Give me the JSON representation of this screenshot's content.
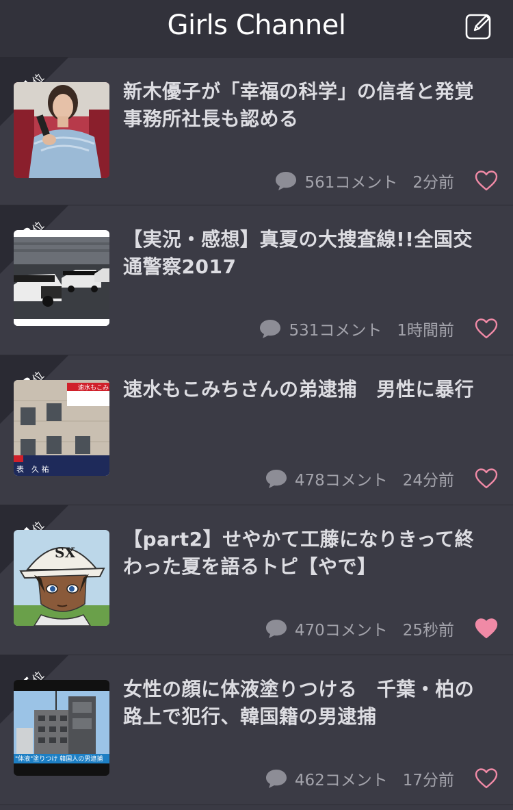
{
  "header": {
    "title": "Girls Channel",
    "compose_icon": "compose-icon"
  },
  "colors": {
    "background": "#3a3a44",
    "header": "#32323b",
    "heart": "#f08aa6",
    "text": "#dddde2",
    "meta": "#a3a3ab"
  },
  "unit": "位",
  "items": [
    {
      "rank": "11",
      "title_line1": "新木優子が「幸福の科学」の信者と発覚",
      "title_line2": "事務所社長も認める",
      "comments": "561コメント",
      "time": "2分前",
      "liked": false
    },
    {
      "rank": "12",
      "title_line1": "【実況・感想】真夏の大捜査線!!全国交",
      "title_line2": "通警察2017",
      "comments": "531コメント",
      "time": "1時間前",
      "liked": false
    },
    {
      "rank": "13",
      "title_line1": "速水もこみちさんの弟逮捕　男性に暴行",
      "title_line2": "",
      "comments": "478コメント",
      "time": "24分前",
      "liked": false,
      "thumb_caption_top": "速水もこみち",
      "thumb_caption_bottom": "表　久 祐"
    },
    {
      "rank": "14",
      "title_line1": "【part2】せやかて工藤になりきって終",
      "title_line2": "わった夏を語るトピ【やで】",
      "comments": "470コメント",
      "time": "25秒前",
      "liked": true
    },
    {
      "rank": "15",
      "title_line1": "女性の顔に体液塗りつける　千葉・柏の",
      "title_line2": "路上で犯行、韓国籍の男逮捕",
      "comments": "462コメント",
      "time": "17分前",
      "liked": false,
      "thumb_caption_bottom": "\"体液\"塗りつけ 韓国人の男逮捕"
    }
  ]
}
